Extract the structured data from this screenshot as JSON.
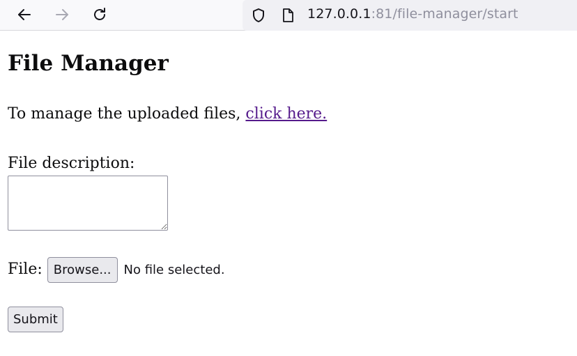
{
  "browser": {
    "url_host": "127.0.0.1",
    "url_rest": ":81/file-manager/start",
    "icons": {
      "back": "arrow-left-icon",
      "forward": "arrow-right-icon",
      "reload": "reload-icon",
      "shield": "shield-icon",
      "page": "page-icon"
    },
    "forward_enabled": false
  },
  "page": {
    "title": "File Manager",
    "intro_text": "To manage the uploaded files, ",
    "intro_link": "click here.",
    "description_label": "File description:",
    "description_value": "",
    "file_label": "File:",
    "browse_label": "Browse...",
    "file_status": "No file selected.",
    "submit_label": "Submit"
  },
  "colors": {
    "visited_link": "#551a8b",
    "button_bg": "#e9e9ed",
    "url_dim": "#8f8f9d"
  }
}
